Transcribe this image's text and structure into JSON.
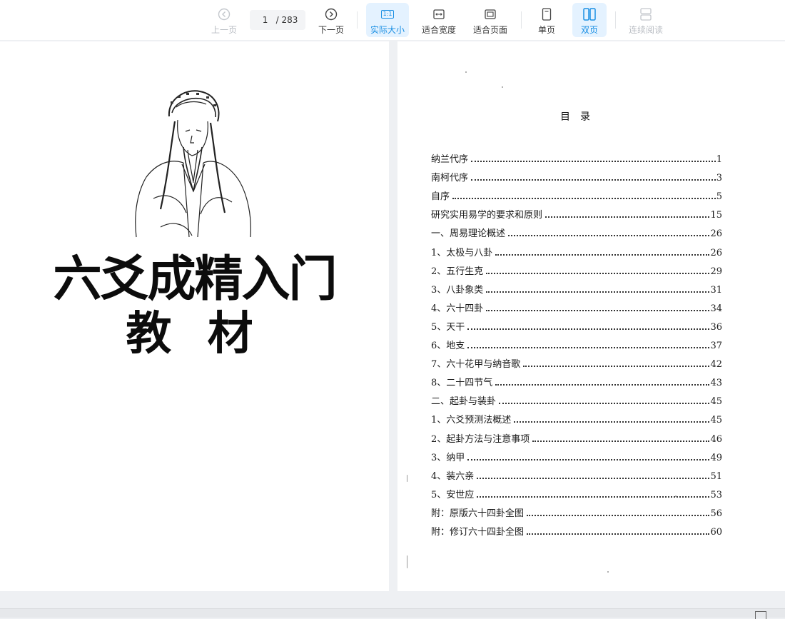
{
  "toolbar": {
    "prev_label": "上一页",
    "page_current": "1",
    "page_total": "/ 283",
    "next_label": "下一页",
    "actual_size_label": "实际大小",
    "actual_size_icon_text": "1:1",
    "fit_width_label": "适合宽度",
    "fit_page_label": "适合页面",
    "single_page_label": "单页",
    "double_page_label": "双页",
    "continuous_label": "连续阅读",
    "accent_color": "#1a8fe3"
  },
  "left_page": {
    "title_line1": "六爻成精入门",
    "title_line2": "教 材"
  },
  "right_page": {
    "heading": "目录",
    "toc": [
      {
        "title": "纳兰代序",
        "page": "1"
      },
      {
        "title": "南柯代序",
        "page": "3"
      },
      {
        "title": "自序",
        "page": "5"
      },
      {
        "title": "研究实用易学的要求和原则",
        "page": "15"
      },
      {
        "title": "一、周易理论概述",
        "page": "26"
      },
      {
        "title": "1、太极与八卦",
        "page": "26"
      },
      {
        "title": "2、五行生克",
        "page": "29"
      },
      {
        "title": "3、八卦象类",
        "page": "31"
      },
      {
        "title": "4、六十四卦",
        "page": "34"
      },
      {
        "title": "5、天干",
        "page": "36"
      },
      {
        "title": "6、地支",
        "page": "37"
      },
      {
        "title": "7、六十花甲与纳音歌",
        "page": "42"
      },
      {
        "title": "8、二十四节气",
        "page": "43"
      },
      {
        "title": "二、起卦与装卦",
        "page": "45"
      },
      {
        "title": "1、六爻预测法概述",
        "page": "45"
      },
      {
        "title": "2、起卦方法与注意事项",
        "page": "46"
      },
      {
        "title": "3、纳甲",
        "page": "49"
      },
      {
        "title": "4、装六亲",
        "page": "51"
      },
      {
        "title": "5、安世应",
        "page": "53"
      },
      {
        "title": "附：原版六十四卦全图",
        "page": "56"
      },
      {
        "title": "附：修订六十四卦全图",
        "page": "60"
      }
    ]
  }
}
